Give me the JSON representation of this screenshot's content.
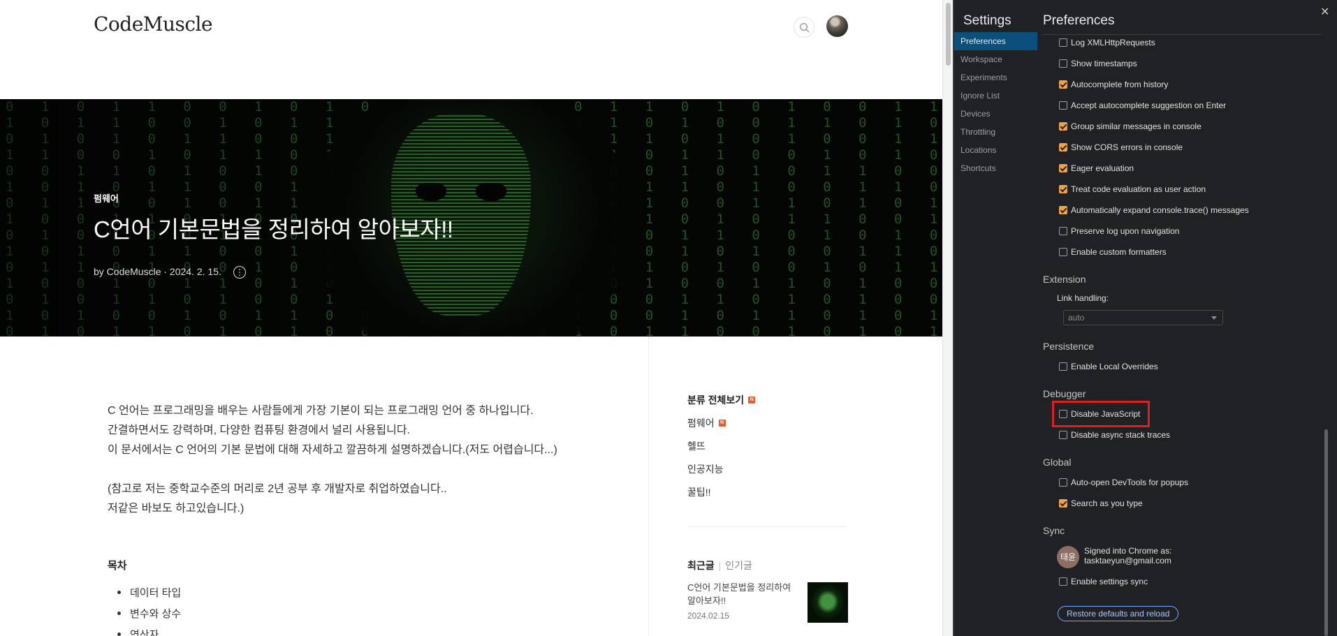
{
  "blog": {
    "logo": "CodeMuscle",
    "hero": {
      "category": "펌웨어",
      "title": "C언어 기본문법을 정리하여 알아보자!!",
      "meta": "by CodeMuscle · 2024. 2. 15."
    },
    "article": {
      "paragraphs": [
        "C 언어는 프로그래밍을 배우는 사람들에게 가장 기본이 되는 프로그래밍 언어 중 하나입니다.",
        "간결하면서도 강력하며, 다양한 컴퓨팅 환경에서 널리 사용됩니다.",
        "이 문서에서는 C 언어의 기본 문법에 대해 자세하고 깔끔하게 설명하겠습니다.(저도 어렵습니다...)",
        "",
        "(참고로 저는 중학교수준의 머리로 2년 공부 후 개발자로 취업하였습니다..",
        "저같은 바보도 하고있습니다.)"
      ],
      "toc_title": "목차",
      "toc_items": [
        "데이터 타입",
        "변수와 상수",
        "연산자"
      ]
    },
    "sidebar": {
      "categories": [
        {
          "label": "분류 전체보기",
          "new": true
        },
        {
          "label": "펌웨어",
          "new": true
        },
        {
          "label": "헬뜨",
          "new": false
        },
        {
          "label": "인공지능",
          "new": false
        },
        {
          "label": "꿀팁!!",
          "new": false
        }
      ],
      "new_badge": "N",
      "recent_tab": "최근글",
      "popular_tab": "인기글",
      "recent_title": "C언어 기본문법을 정리하여 알아보자!!",
      "recent_date": "2024.02.15"
    }
  },
  "devtools": {
    "settings_title": "Settings",
    "nav": [
      "Preferences",
      "Workspace",
      "Experiments",
      "Ignore List",
      "Devices",
      "Throttling",
      "Locations",
      "Shortcuts"
    ],
    "active_nav": "Preferences",
    "pane_title": "Preferences",
    "console_options": [
      {
        "label": "Log XMLHttpRequests",
        "checked": false
      },
      {
        "label": "Show timestamps",
        "checked": false
      },
      {
        "label": "Autocomplete from history",
        "checked": true
      },
      {
        "label": "Accept autocomplete suggestion on Enter",
        "checked": false
      },
      {
        "label": "Group similar messages in console",
        "checked": true
      },
      {
        "label": "Show CORS errors in console",
        "checked": true
      },
      {
        "label": "Eager evaluation",
        "checked": true
      },
      {
        "label": "Treat code evaluation as user action",
        "checked": true
      },
      {
        "label": "Automatically expand console.trace() messages",
        "checked": true
      },
      {
        "label": "Preserve log upon navigation",
        "checked": false
      },
      {
        "label": "Enable custom formatters",
        "checked": false
      }
    ],
    "extension": {
      "heading": "Extension",
      "link_label": "Link handling:",
      "link_value": "auto"
    },
    "persistence": {
      "heading": "Persistence",
      "options": [
        {
          "label": "Enable Local Overrides",
          "checked": false
        }
      ]
    },
    "debugger": {
      "heading": "Debugger",
      "options": [
        {
          "label": "Disable JavaScript",
          "checked": false
        },
        {
          "label": "Disable async stack traces",
          "checked": false
        }
      ]
    },
    "global": {
      "heading": "Global",
      "options": [
        {
          "label": "Auto-open DevTools for popups",
          "checked": false
        },
        {
          "label": "Search as you type",
          "checked": true
        }
      ]
    },
    "sync": {
      "heading": "Sync",
      "avatar_text": "태윤",
      "signed_in_line": "Signed into Chrome as:",
      "email": "tasktaeyun@gmail.com",
      "options": [
        {
          "label": "Enable settings sync",
          "checked": false
        }
      ]
    },
    "restore_button": "Restore defaults and reload",
    "close_glyph": "✕",
    "colors": {
      "checkbox_on": "#f2a341",
      "nav_active": "#0b4f7c",
      "highlight_box": "#e02020"
    }
  }
}
